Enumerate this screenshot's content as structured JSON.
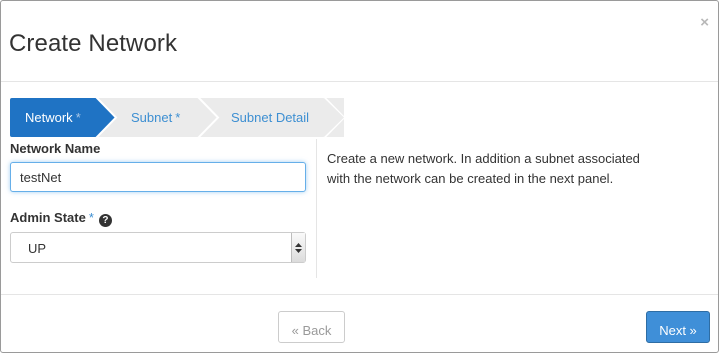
{
  "modal": {
    "title": "Create Network",
    "close_label": "×"
  },
  "wizard": {
    "steps": [
      {
        "label": "Network",
        "required_mark": "*",
        "active": true
      },
      {
        "label": "Subnet",
        "required_mark": "*",
        "active": false
      },
      {
        "label": "Subnet Detail",
        "required_mark": "",
        "active": false
      }
    ]
  },
  "form": {
    "network_name": {
      "label": "Network Name",
      "value": "testNet"
    },
    "admin_state": {
      "label": "Admin State",
      "required_mark": "*",
      "help_icon": "?",
      "selected": "UP"
    }
  },
  "description": "Create a new network. In addition a subnet associated with the network can be created in the next panel.",
  "footer": {
    "back_label": "« Back",
    "next_label": "Next »"
  },
  "colors": {
    "accent": "#3f8fd8",
    "active_step": "#1f73c4",
    "link_blue": "#3d8fd2"
  },
  "icons": {
    "close": "close-icon",
    "help": "question-circle-icon",
    "select_arrows": "updown-arrows-icon"
  }
}
